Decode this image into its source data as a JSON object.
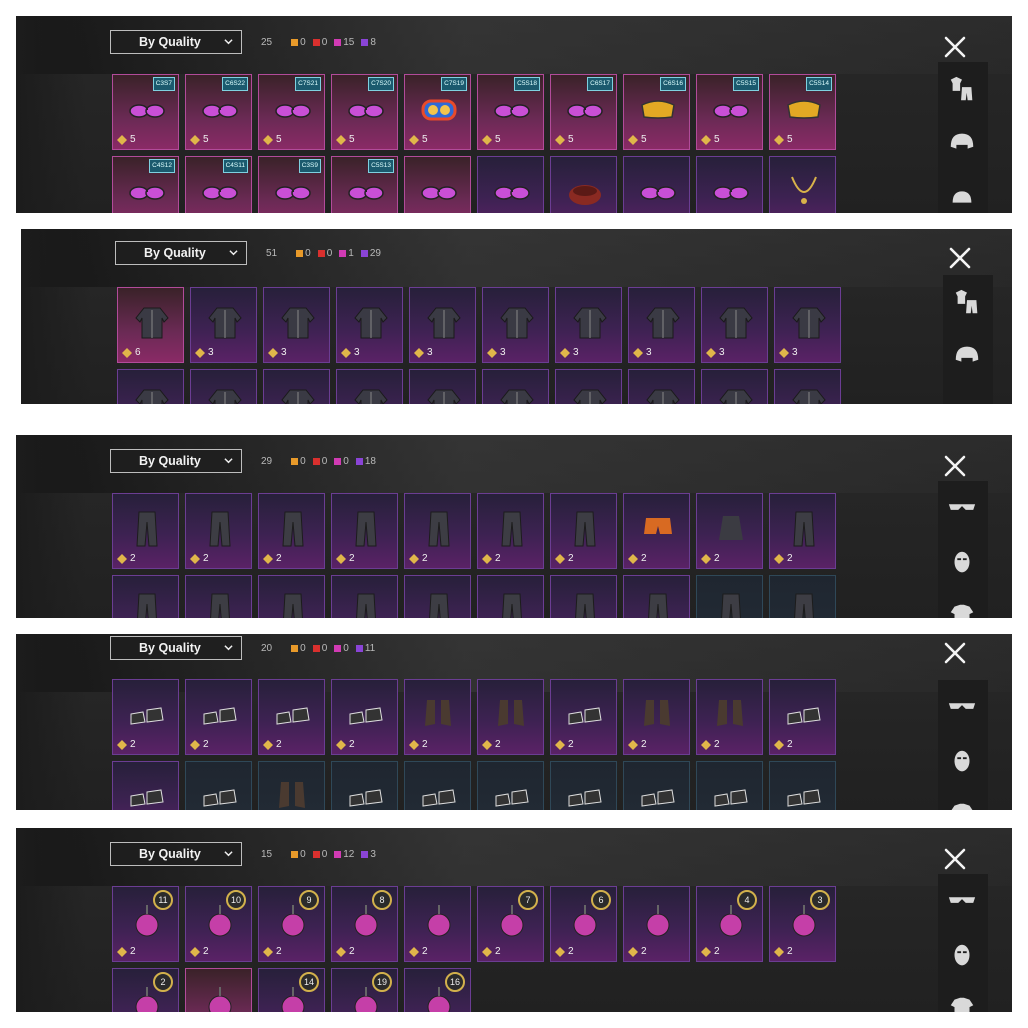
{
  "sort_label": "By Quality",
  "close_icon": "close-icon",
  "quality_colors": {
    "orange": "#e89a2a",
    "red": "#d9302e",
    "pink": "#d13bb4",
    "purple": "#8a44d6"
  },
  "panels": [
    {
      "name": "glasses",
      "total": "25",
      "counts": [
        "0",
        "0",
        "15",
        "8"
      ],
      "side_icons": [
        "shirt-pants-icon",
        "helmet-icon",
        "cap-icon"
      ],
      "rows": [
        [
          {
            "icon": "mask-icon",
            "cost": "5",
            "badge": "C3S7",
            "style": "gold"
          },
          {
            "icon": "glasses-icon",
            "cost": "5",
            "badge": "C6S22",
            "style": "gold"
          },
          {
            "icon": "glasses-icon",
            "cost": "5",
            "badge": "C7S21",
            "style": "gold"
          },
          {
            "icon": "glasses-icon",
            "cost": "5",
            "badge": "C7S20",
            "style": "gold"
          },
          {
            "icon": "goggles-icon",
            "cost": "5",
            "badge": "C7S19",
            "style": "gold"
          },
          {
            "icon": "glasses-icon",
            "cost": "5",
            "badge": "C5S18",
            "style": "gold"
          },
          {
            "icon": "glasses-icon",
            "cost": "5",
            "badge": "C6S17",
            "style": "gold"
          },
          {
            "icon": "visor-icon",
            "cost": "5",
            "badge": "C6S16",
            "style": "gold"
          },
          {
            "icon": "glasses-icon",
            "cost": "5",
            "badge": "C5S15",
            "style": "gold"
          },
          {
            "icon": "visor-icon",
            "cost": "5",
            "badge": "C5S14",
            "style": "gold"
          }
        ],
        [
          {
            "icon": "glasses-icon",
            "cost": "",
            "badge": "C4S12",
            "style": "gold"
          },
          {
            "icon": "glasses-icon",
            "cost": "",
            "badge": "C4S11",
            "style": "gold"
          },
          {
            "icon": "glasses-icon",
            "cost": "",
            "badge": "C3S9",
            "style": "gold"
          },
          {
            "icon": "glasses-icon",
            "cost": "",
            "badge": "C5S13",
            "style": "gold"
          },
          {
            "icon": "glasses-icon",
            "cost": "",
            "badge": "",
            "style": "gold"
          },
          {
            "icon": "glasses-icon",
            "cost": "",
            "badge": "",
            "style": "purple"
          },
          {
            "icon": "scarf-icon",
            "cost": "",
            "badge": "",
            "style": "purple"
          },
          {
            "icon": "glasses-icon",
            "cost": "",
            "badge": "",
            "style": "purple"
          },
          {
            "icon": "glasses-icon",
            "cost": "",
            "badge": "",
            "style": "purple"
          },
          {
            "icon": "chain-icon",
            "cost": "",
            "badge": "",
            "style": "purple"
          }
        ]
      ]
    },
    {
      "name": "jackets",
      "total": "51",
      "counts": [
        "0",
        "0",
        "1",
        "29"
      ],
      "side_icons": [
        "shirt-pants-icon",
        "helmet-icon"
      ],
      "rows": [
        [
          {
            "icon": "coat-icon",
            "cost": "6",
            "badge": "",
            "style": "gold"
          },
          {
            "icon": "jacket-icon",
            "cost": "3",
            "badge": "",
            "style": "purple"
          },
          {
            "icon": "jacket-icon",
            "cost": "3",
            "badge": "",
            "style": "purple"
          },
          {
            "icon": "jacket-icon",
            "cost": "3",
            "badge": "",
            "style": "purple"
          },
          {
            "icon": "jacket-icon",
            "cost": "3",
            "badge": "",
            "style": "purple"
          },
          {
            "icon": "jacket-icon",
            "cost": "3",
            "badge": "",
            "style": "purple"
          },
          {
            "icon": "jacket-icon",
            "cost": "3",
            "badge": "",
            "style": "purple"
          },
          {
            "icon": "jacket-icon",
            "cost": "3",
            "badge": "",
            "style": "purple"
          },
          {
            "icon": "jacket-icon",
            "cost": "3",
            "badge": "",
            "style": "purple"
          },
          {
            "icon": "jacket-icon",
            "cost": "3",
            "badge": "",
            "style": "purple"
          }
        ],
        [
          {
            "icon": "jacket-icon",
            "cost": "",
            "badge": "",
            "style": "purple"
          },
          {
            "icon": "jacket-icon",
            "cost": "",
            "badge": "",
            "style": "purple"
          },
          {
            "icon": "jacket-icon",
            "cost": "",
            "badge": "",
            "style": "purple"
          },
          {
            "icon": "jacket-icon",
            "cost": "",
            "badge": "",
            "style": "purple"
          },
          {
            "icon": "jacket-icon",
            "cost": "",
            "badge": "",
            "style": "purple"
          },
          {
            "icon": "jacket-icon",
            "cost": "",
            "badge": "",
            "style": "purple"
          },
          {
            "icon": "jacket-icon",
            "cost": "",
            "badge": "",
            "style": "purple"
          },
          {
            "icon": "jacket-icon",
            "cost": "",
            "badge": "",
            "style": "purple"
          },
          {
            "icon": "jacket-icon",
            "cost": "",
            "badge": "",
            "style": "purple"
          },
          {
            "icon": "jacket-icon",
            "cost": "",
            "badge": "",
            "style": "purple"
          }
        ]
      ]
    },
    {
      "name": "pants",
      "total": "29",
      "counts": [
        "0",
        "0",
        "0",
        "18"
      ],
      "side_icons": [
        "sunglasses-icon",
        "mask-face-icon",
        "shirt-icon"
      ],
      "rows": [
        [
          {
            "icon": "pants-icon",
            "cost": "2",
            "badge": "",
            "style": "purple"
          },
          {
            "icon": "pants-icon",
            "cost": "2",
            "badge": "",
            "style": "purple"
          },
          {
            "icon": "pants-icon",
            "cost": "2",
            "badge": "",
            "style": "purple"
          },
          {
            "icon": "pants-icon",
            "cost": "2",
            "badge": "",
            "style": "purple"
          },
          {
            "icon": "pants-icon",
            "cost": "2",
            "badge": "",
            "style": "purple"
          },
          {
            "icon": "pants-icon",
            "cost": "2",
            "badge": "",
            "style": "purple"
          },
          {
            "icon": "pants-icon",
            "cost": "2",
            "badge": "",
            "style": "purple"
          },
          {
            "icon": "shorts-icon",
            "cost": "2",
            "badge": "",
            "style": "purple"
          },
          {
            "icon": "skirt-icon",
            "cost": "2",
            "badge": "",
            "style": "purple"
          },
          {
            "icon": "pants-icon",
            "cost": "2",
            "badge": "",
            "style": "purple"
          }
        ],
        [
          {
            "icon": "pants-icon",
            "cost": "",
            "badge": "",
            "style": "purple"
          },
          {
            "icon": "pants-icon",
            "cost": "",
            "badge": "",
            "style": "purple"
          },
          {
            "icon": "pants-icon",
            "cost": "",
            "badge": "",
            "style": "purple"
          },
          {
            "icon": "pants-icon",
            "cost": "",
            "badge": "",
            "style": "purple"
          },
          {
            "icon": "pants-icon",
            "cost": "",
            "badge": "",
            "style": "purple"
          },
          {
            "icon": "pants-icon",
            "cost": "",
            "badge": "",
            "style": "purple"
          },
          {
            "icon": "pants-icon",
            "cost": "",
            "badge": "",
            "style": "purple"
          },
          {
            "icon": "pants-icon",
            "cost": "",
            "badge": "",
            "style": "purple"
          },
          {
            "icon": "pants-icon",
            "cost": "",
            "badge": "",
            "style": "blue"
          },
          {
            "icon": "pants-icon",
            "cost": "",
            "badge": "",
            "style": "blue"
          }
        ]
      ]
    },
    {
      "name": "shoes",
      "total": "20",
      "counts": [
        "0",
        "0",
        "0",
        "11"
      ],
      "side_icons": [
        "sunglasses-icon",
        "mask-face-icon",
        "shirt-icon"
      ],
      "rows": [
        [
          {
            "icon": "shoes-icon",
            "cost": "2",
            "badge": "",
            "style": "purple"
          },
          {
            "icon": "shoes-icon",
            "cost": "2",
            "badge": "",
            "style": "purple"
          },
          {
            "icon": "shoes-icon",
            "cost": "2",
            "badge": "",
            "style": "purple"
          },
          {
            "icon": "sandals-icon",
            "cost": "2",
            "badge": "",
            "style": "purple"
          },
          {
            "icon": "boots-icon",
            "cost": "2",
            "badge": "",
            "style": "purple"
          },
          {
            "icon": "boots-icon",
            "cost": "2",
            "badge": "",
            "style": "purple"
          },
          {
            "icon": "shoes-icon",
            "cost": "2",
            "badge": "",
            "style": "purple"
          },
          {
            "icon": "boots-icon",
            "cost": "2",
            "badge": "",
            "style": "purple"
          },
          {
            "icon": "boots-icon",
            "cost": "2",
            "badge": "",
            "style": "purple"
          },
          {
            "icon": "shoes-icon",
            "cost": "2",
            "badge": "",
            "style": "purple"
          }
        ],
        [
          {
            "icon": "shoes-icon",
            "cost": "",
            "badge": "",
            "style": "purple"
          },
          {
            "icon": "shoes-icon",
            "cost": "",
            "badge": "",
            "style": "blue"
          },
          {
            "icon": "boots-icon",
            "cost": "",
            "badge": "",
            "style": "blue"
          },
          {
            "icon": "shoes-icon",
            "cost": "",
            "badge": "",
            "style": "blue"
          },
          {
            "icon": "shoes-icon",
            "cost": "",
            "badge": "",
            "style": "blue"
          },
          {
            "icon": "shoes-icon",
            "cost": "",
            "badge": "",
            "style": "blue"
          },
          {
            "icon": "shoes-icon",
            "cost": "",
            "badge": "",
            "style": "blue"
          },
          {
            "icon": "shoes-icon",
            "cost": "",
            "badge": "",
            "style": "blue"
          },
          {
            "icon": "shoes-icon",
            "cost": "",
            "badge": "",
            "style": "blue"
          },
          {
            "icon": "shoes-icon",
            "cost": "",
            "badge": "",
            "style": "blue"
          }
        ]
      ]
    },
    {
      "name": "pendants",
      "total": "15",
      "counts": [
        "0",
        "0",
        "12",
        "3"
      ],
      "side_icons": [
        "sunglasses-icon",
        "mask-face-icon",
        "shirt-icon"
      ],
      "rows": [
        [
          {
            "icon": "pendant-icon",
            "cost": "2",
            "badge": "",
            "level": "11",
            "style": "purple"
          },
          {
            "icon": "pendant-icon",
            "cost": "2",
            "badge": "",
            "level": "10",
            "style": "purple"
          },
          {
            "icon": "pendant-icon",
            "cost": "2",
            "badge": "",
            "level": "9",
            "style": "purple"
          },
          {
            "icon": "pendant-icon",
            "cost": "2",
            "badge": "",
            "level": "8",
            "style": "purple"
          },
          {
            "icon": "pendant-icon",
            "cost": "2",
            "badge": "",
            "level": "",
            "style": "purple"
          },
          {
            "icon": "pendant-icon",
            "cost": "2",
            "badge": "",
            "level": "7",
            "style": "purple"
          },
          {
            "icon": "pendant-icon",
            "cost": "2",
            "badge": "",
            "level": "6",
            "style": "purple"
          },
          {
            "icon": "pendant-icon",
            "cost": "2",
            "badge": "",
            "level": "",
            "style": "purple"
          },
          {
            "icon": "pendant-icon",
            "cost": "2",
            "badge": "",
            "level": "4",
            "style": "purple"
          },
          {
            "icon": "pendant-icon",
            "cost": "2",
            "badge": "",
            "level": "3",
            "style": "purple"
          }
        ],
        [
          {
            "icon": "pendant-icon",
            "cost": "",
            "badge": "",
            "level": "2",
            "style": "purple"
          },
          {
            "icon": "pendant-icon",
            "cost": "",
            "badge": "",
            "level": "",
            "style": "gold"
          },
          {
            "icon": "pendant-icon",
            "cost": "",
            "badge": "",
            "level": "14",
            "style": "purple"
          },
          {
            "icon": "pendant-icon",
            "cost": "",
            "badge": "",
            "level": "19",
            "style": "purple"
          },
          {
            "icon": "pendant-icon",
            "cost": "",
            "badge": "",
            "level": "16",
            "style": "purple"
          }
        ]
      ]
    }
  ]
}
